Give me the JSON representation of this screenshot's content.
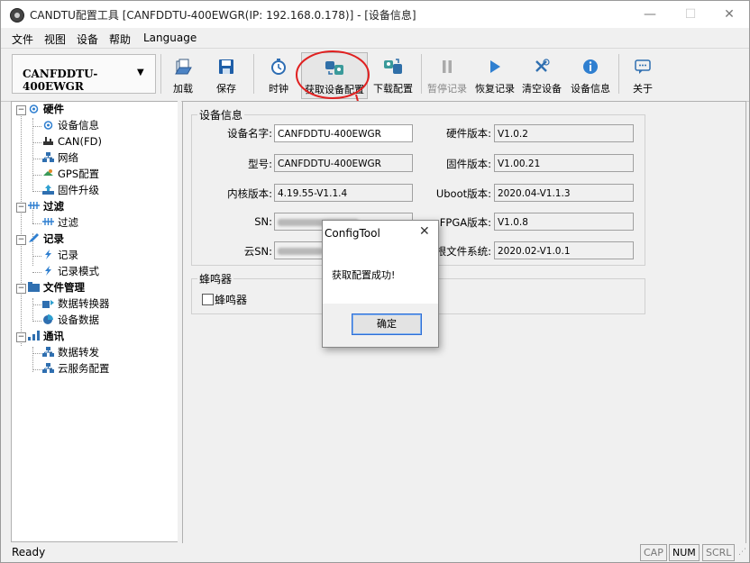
{
  "window": {
    "title": "CANDTU配置工具 [CANFDDTU-400EWGR(IP: 192.168.0.178)] - [设备信息]",
    "minimize": "—",
    "maximize": "☐",
    "close": "✕"
  },
  "menubar": {
    "items": [
      "文件",
      "视图",
      "设备",
      "帮助",
      "Language"
    ]
  },
  "toolbar": {
    "device_name": "CANFDDTU-400EWGR",
    "buttons": [
      {
        "label": "加载",
        "icon": "load-icon"
      },
      {
        "label": "保存",
        "icon": "save-icon"
      },
      {
        "label": "时钟",
        "icon": "clock-icon"
      },
      {
        "label": "获取设备配置",
        "icon": "get-config-icon"
      },
      {
        "label": "下载配置",
        "icon": "download-config-icon"
      },
      {
        "label": "暂停记录",
        "icon": "pause-icon"
      },
      {
        "label": "恢复记录",
        "icon": "play-icon"
      },
      {
        "label": "清空设备",
        "icon": "clear-icon"
      },
      {
        "label": "设备信息",
        "icon": "info-icon"
      },
      {
        "label": "关于",
        "icon": "about-icon"
      }
    ]
  },
  "tree": {
    "hardware": {
      "label": "硬件",
      "children": [
        "设备信息",
        "CAN(FD)",
        "网络",
        "GPS配置",
        "固件升级"
      ]
    },
    "filter": {
      "label": "过滤",
      "children": [
        "过滤"
      ]
    },
    "record": {
      "label": "记录",
      "children": [
        "记录",
        "记录模式"
      ]
    },
    "file_mgmt": {
      "label": "文件管理",
      "children": [
        "数据转换器",
        "设备数据"
      ]
    },
    "comm": {
      "label": "通讯",
      "children": [
        "数据转发",
        "云服务配置"
      ]
    }
  },
  "device_info": {
    "group_title": "设备信息",
    "device_name_label": "设备名字:",
    "device_name": "CANFDDTU-400EWGR",
    "model_label": "型号:",
    "model": "CANFDDTU-400EWGR",
    "kernel_label": "内核版本:",
    "kernel": "4.19.55-V1.1.4",
    "sn_label": "SN:",
    "cloud_sn_label": "云SN:",
    "hw_label": "硬件版本:",
    "hw": "V1.0.2",
    "fw_label": "固件版本:",
    "fw": "V1.00.21",
    "uboot_label": "Uboot版本:",
    "uboot": "2020.04-V1.1.3",
    "fpga_label": "FPGA版本:",
    "fpga": "V1.0.8",
    "rootfs_label": "根文件系统:",
    "rootfs": "2020.02-V1.0.1"
  },
  "buzzer": {
    "group_title": "蜂鸣器",
    "checkbox_label": "蜂鸣器"
  },
  "dialog": {
    "title": "ConfigTool",
    "close": "✕",
    "message": "获取配置成功!",
    "ok": "确定"
  },
  "statusbar": {
    "text": "Ready",
    "cap": "CAP",
    "num": "NUM",
    "scrl": "SCRL"
  },
  "colors": {
    "annotation_red": "#e02020",
    "selection_blue": "#2f6fd6"
  }
}
